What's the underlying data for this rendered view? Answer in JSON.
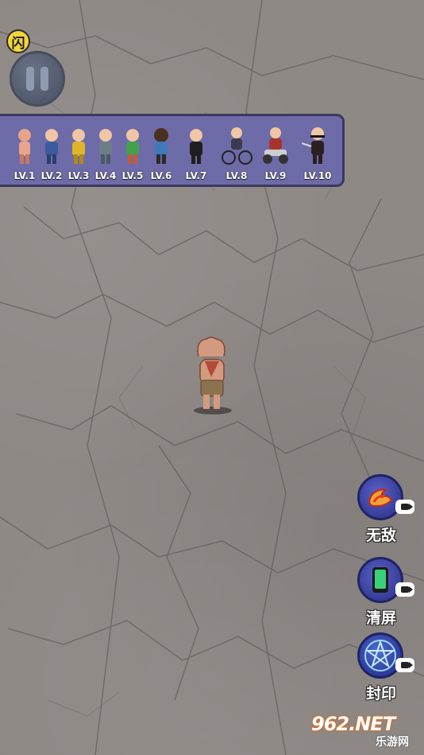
{
  "hud": {
    "badge_text": "闪",
    "pause_icon": "pause-icon"
  },
  "levels": [
    {
      "label": "LV.1",
      "color": "#e8a58a"
    },
    {
      "label": "LV.2",
      "color": "#3d5a9c"
    },
    {
      "label": "LV.3",
      "color": "#e0b52a"
    },
    {
      "label": "LV.4",
      "color": "#6d7f86"
    },
    {
      "label": "LV.5",
      "color": "#43a04d"
    },
    {
      "label": "LV.6",
      "color": "#3f79b8"
    },
    {
      "label": "LV.7",
      "color": "#1e1e1e"
    },
    {
      "label": "LV.8",
      "color": "#3a3a50"
    },
    {
      "label": "LV.9",
      "color": "#a6342c"
    },
    {
      "label": "LV.10",
      "color": "#2a2020"
    }
  ],
  "skills": [
    {
      "label": "无敌",
      "icon": "flame-swirl-icon"
    },
    {
      "label": "清屏",
      "icon": "phone-icon"
    },
    {
      "label": "封印",
      "icon": "pentagram-icon"
    }
  ],
  "watermark": {
    "logo": "962.NET",
    "sub": "乐游网"
  }
}
